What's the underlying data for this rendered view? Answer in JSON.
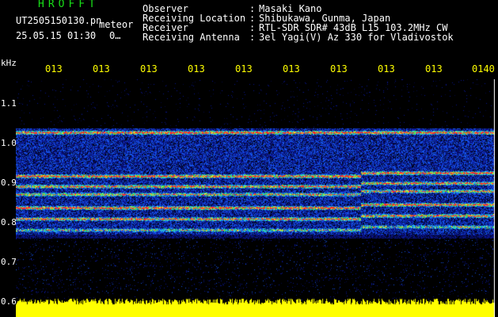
{
  "header": {
    "brand": "HROFFT",
    "filename": "UT2505150130.pn",
    "meteor_label": "meteor",
    "datetime": "25.05.15 01:30",
    "meteor_count": "0…",
    "rows": [
      {
        "label": "Observer",
        "value": "Masaki Kano"
      },
      {
        "label": "Receiving Location",
        "value": "Shibukawa, Gunma, Japan"
      },
      {
        "label": "Receiver",
        "value": "RTL-SDR SDR# 43dB L15 103.2MHz CW"
      },
      {
        "label": "Receiving Antenna",
        "value": "3el Yagi(V) Az 330 for Vladivostok"
      }
    ]
  },
  "yaxis": {
    "unit": "kHz",
    "ticks": [
      "1.1",
      "1.0",
      "0.9",
      "0.8",
      "0.7",
      "0.6"
    ]
  },
  "xaxis": {
    "ticks": [
      "013",
      "013",
      "013",
      "013",
      "013",
      "013",
      "013",
      "013",
      "013",
      "0140"
    ]
  },
  "colors": {
    "background": "#000000",
    "brand": "#18e018",
    "ticks": "#ffff00",
    "spectrum_low": "#0a1060",
    "spectrum_mid": "#1f6cff",
    "spectrum_high": "#ff2a2a",
    "baseline": "#ffff00"
  }
}
